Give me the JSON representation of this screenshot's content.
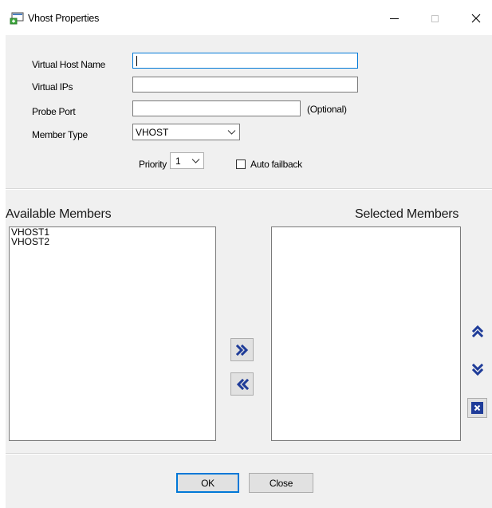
{
  "window": {
    "title": "Vhost Properties",
    "minimize_glyph": "—",
    "maximize_glyph": "☐",
    "close_glyph": "✕"
  },
  "form": {
    "virtual_host_name_label": "Virtual Host Name",
    "virtual_host_name_value": "",
    "virtual_ips_label": "Virtual IPs",
    "virtual_ips_value": "",
    "probe_port_label": "Probe Port",
    "probe_port_value": "",
    "probe_port_hint": "(Optional)",
    "member_type_label": "Member Type",
    "member_type_value": "VHOST",
    "priority_label": "Priority",
    "priority_value": "1",
    "auto_failback_label": "Auto failback",
    "auto_failback_checked": false
  },
  "members": {
    "available_heading": "Available Members",
    "selected_heading": "Selected Members",
    "available_items": [
      "VHOST1",
      "VHOST2"
    ],
    "selected_items": []
  },
  "footer": {
    "ok_label": "OK",
    "close_label": "Close"
  },
  "colors": {
    "accent": "#0078d7",
    "icon_blue": "#1f3c99",
    "client_bg": "#f0f0f0"
  }
}
